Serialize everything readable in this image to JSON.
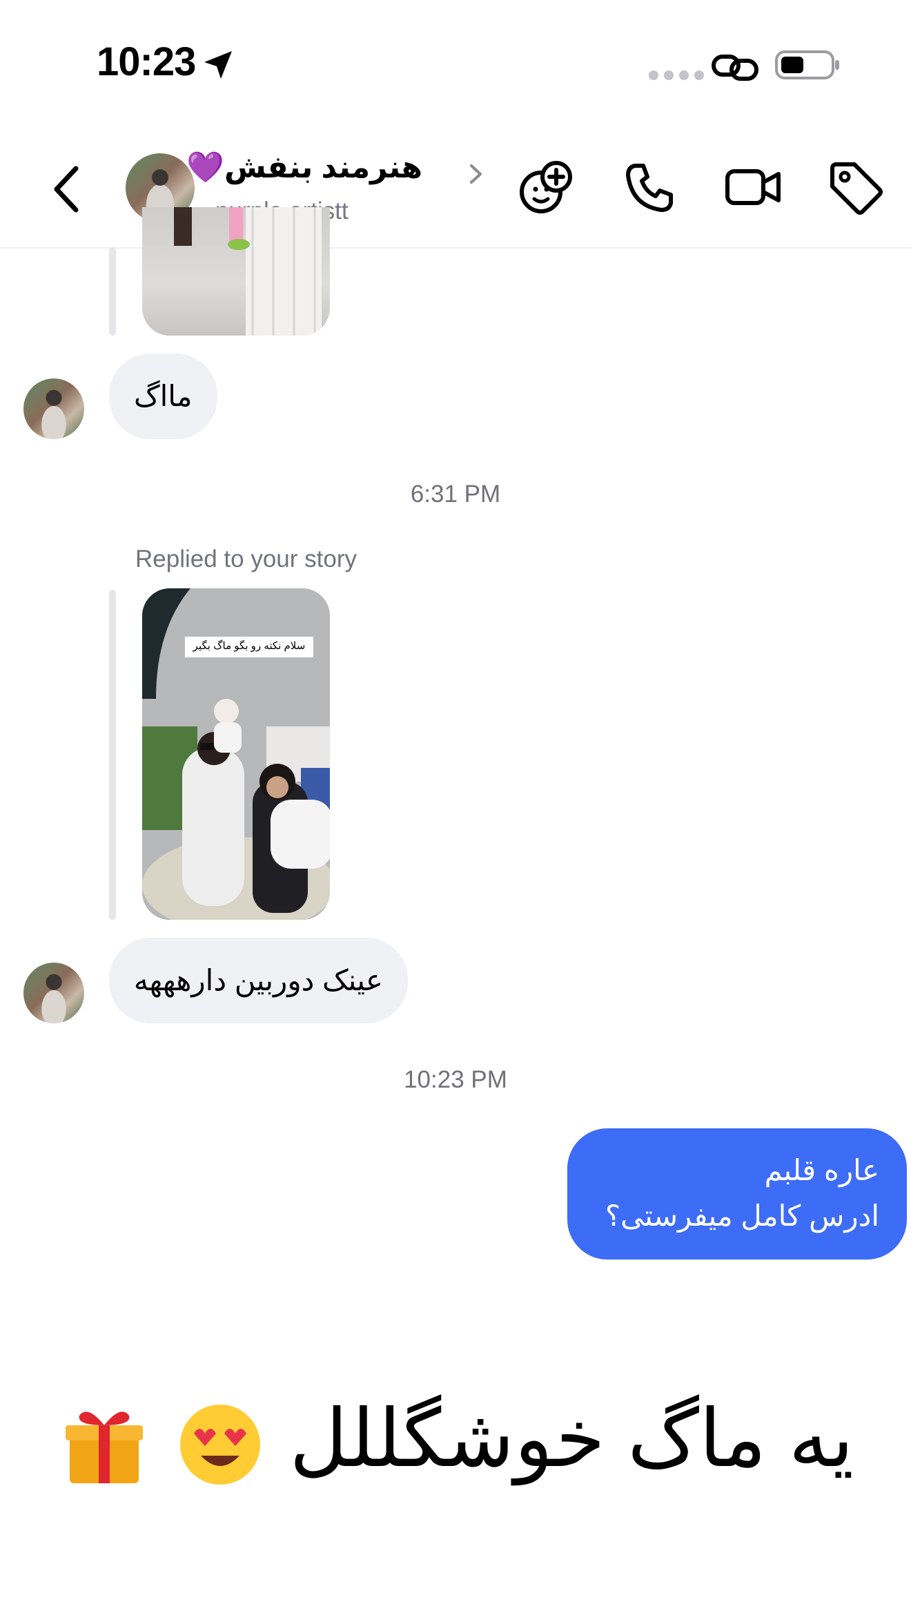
{
  "status_bar": {
    "time": "10:23",
    "location_icon": "location-arrow-icon",
    "link_icon": "link-icon",
    "battery_icon": "battery-icon"
  },
  "header": {
    "name": "هنرمند بنفش💜",
    "username": "purple.artistt",
    "icons": [
      "back-arrow-icon",
      "sticker-add-icon",
      "phone-icon",
      "video-icon",
      "tag-icon"
    ]
  },
  "thread": {
    "msg1": "مااگ",
    "time1": "6:31 PM",
    "reply_label": "Replied to your story",
    "story_caption": "سلام نکته رو بگو ماگ بگیر",
    "msg2": "عینک دوربین دارهههه",
    "time2": "10:23 PM",
    "outgoing": [
      "عاره قلبم",
      "ادرس کامل میفرستی؟"
    ],
    "big_text": "یه ماگ خوشگللل"
  },
  "colors": {
    "accent_blue": "#3d6cf6",
    "bubble_gray": "#f0f1f4",
    "muted_text": "#747680"
  }
}
